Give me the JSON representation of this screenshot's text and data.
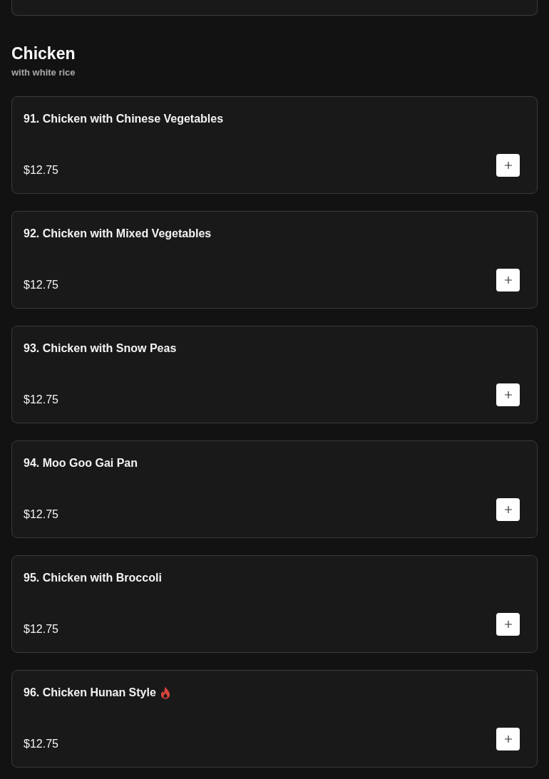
{
  "section": {
    "title": "Chicken",
    "subtitle": "with white rice"
  },
  "items": [
    {
      "name": "91. Chicken with Chinese Vegetables",
      "price": "$12.75",
      "spicy": false
    },
    {
      "name": "92. Chicken with Mixed Vegetables",
      "price": "$12.75",
      "spicy": false
    },
    {
      "name": "93. Chicken with Snow Peas",
      "price": "$12.75",
      "spicy": false
    },
    {
      "name": "94. Moo Goo Gai Pan",
      "price": "$12.75",
      "spicy": false
    },
    {
      "name": "95. Chicken with Broccoli",
      "price": "$12.75",
      "spicy": false
    },
    {
      "name": "96. Chicken Hunan Style",
      "price": "$12.75",
      "spicy": true
    }
  ]
}
